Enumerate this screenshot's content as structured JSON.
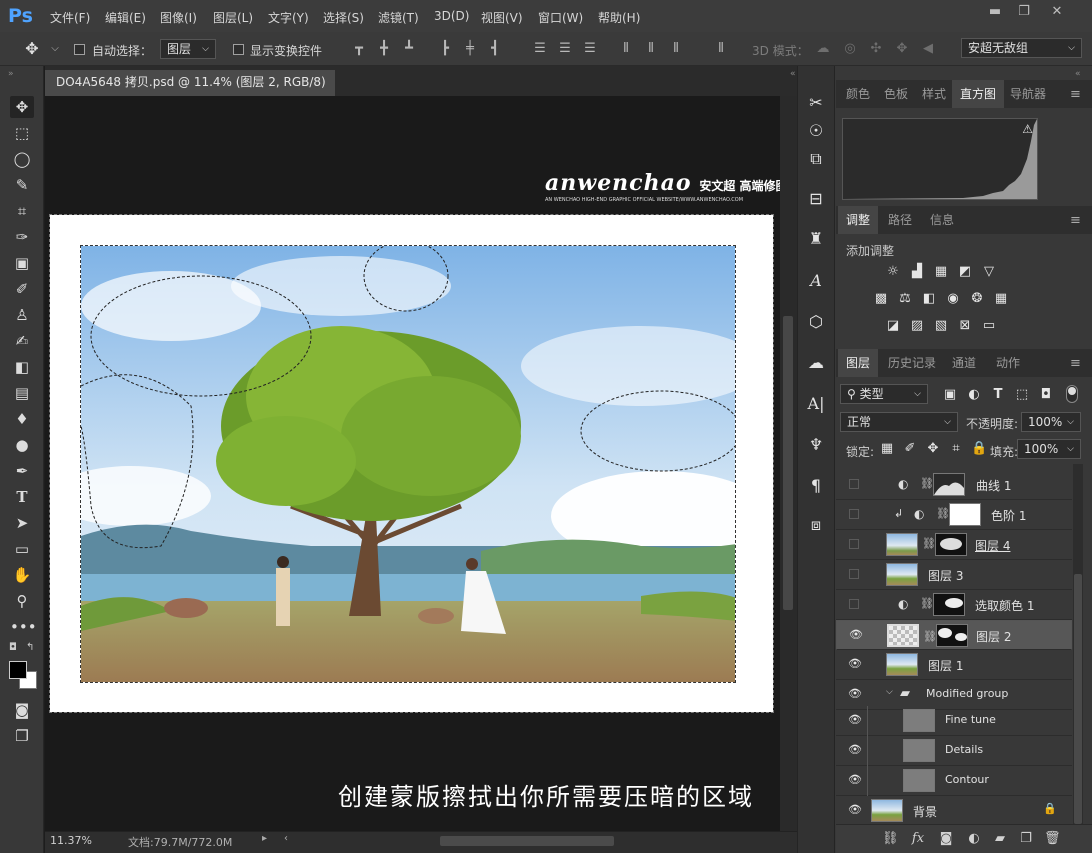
{
  "app": {
    "logo": "Ps"
  },
  "menu": [
    "文件(F)",
    "编辑(E)",
    "图像(I)",
    "图层(L)",
    "文字(Y)",
    "选择(S)",
    "滤镜(T)",
    "3D(D)",
    "视图(V)",
    "窗口(W)",
    "帮助(H)"
  ],
  "window_buttons": {
    "minimize": "▬",
    "restore": "❐",
    "close": "✕"
  },
  "options": {
    "auto_select_label": "自动选择：",
    "auto_select_target": "图层",
    "show_transform_label": "显示变换控件",
    "mode_3d_label": "3D 模式：",
    "workspace": "安超无敌组"
  },
  "document": {
    "tab_title": "DO4A5648 拷贝.psd @ 11.4% (图层 2, RGB/8) *",
    "tab_close": "×",
    "zoom": "11.37%",
    "doc_size": "文档:79.7M/772.0M"
  },
  "canvas": {
    "watermark_main": "anwenchao",
    "watermark_cn": "安文超 高端修图",
    "watermark_sub": "AN WENCHAO HIGH-END GRAPHIC OFFICIAL WEBSITE/WWW.ANWENCHAO.COM",
    "caption": "创建蒙版擦拭出你所需要压暗的区域"
  },
  "panels": {
    "top_tabs": [
      "颜色",
      "色板",
      "样式",
      "直方图",
      "导航器"
    ],
    "top_active": "直方图",
    "mid_tabs": [
      "调整",
      "路径",
      "信息"
    ],
    "mid_active": "调整",
    "adjust_title": "添加调整",
    "layer_tabs": [
      "图层",
      "历史记录",
      "通道",
      "动作"
    ],
    "layer_active": "图层",
    "filter_kind": "类型",
    "blend_mode": "正常",
    "opacity_label": "不透明度:",
    "opacity_value": "100%",
    "lock_label": "锁定:",
    "fill_label": "填充:",
    "fill_value": "100%",
    "histogram_warning": "⚠"
  },
  "layers": [
    {
      "name": "曲线 1",
      "visible": false,
      "type": "adjustment"
    },
    {
      "name": "色阶 1",
      "visible": false,
      "type": "adjustment"
    },
    {
      "name": "图层 4",
      "visible": false,
      "type": "pixel"
    },
    {
      "name": "图层 3",
      "visible": false,
      "type": "pixel"
    },
    {
      "name": "选取颜色 1",
      "visible": false,
      "type": "adjustment"
    },
    {
      "name": "图层 2",
      "visible": true,
      "type": "pixel",
      "selected": true
    },
    {
      "name": "图层 1",
      "visible": true,
      "type": "pixel"
    },
    {
      "name": "Modified group",
      "visible": true,
      "type": "group"
    },
    {
      "name": "Fine tune",
      "visible": true,
      "type": "pixel"
    },
    {
      "name": "Details",
      "visible": true,
      "type": "pixel"
    },
    {
      "name": "Contour",
      "visible": true,
      "type": "pixel"
    },
    {
      "name": "背景",
      "visible": true,
      "type": "background",
      "locked": true
    }
  ],
  "colors": {
    "accent": "#4fa3ff",
    "panel": "#383838",
    "selected_layer": "#575757"
  }
}
